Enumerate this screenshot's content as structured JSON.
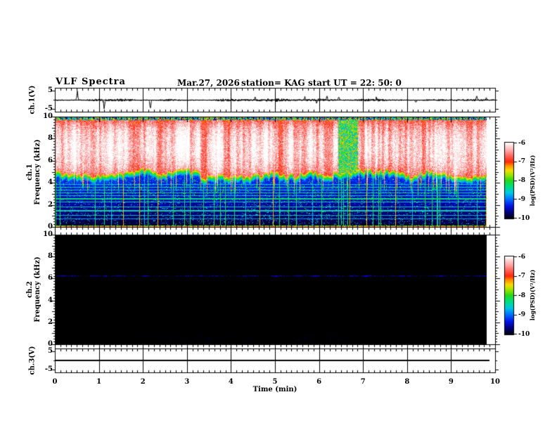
{
  "header": {
    "title": "VLF Spectra",
    "date": "Mar.27, 2026",
    "station": "station= KAG",
    "start_ut": "start UT =  22: 50: 0"
  },
  "time_axis": {
    "label": "Time (min)",
    "ticks": [
      "0",
      "1",
      "2",
      "3",
      "4",
      "5",
      "6",
      "7",
      "8",
      "9",
      "10"
    ],
    "range_min": [
      0,
      10
    ],
    "minor_ticks_per_major": 8
  },
  "chart_data": [
    {
      "type": "line",
      "id": "ch1-waveform",
      "ylabel": "ch.1(V)",
      "ylim": [
        -5,
        5
      ],
      "yticks": [
        "5",
        "-5"
      ],
      "baseline_v": 0,
      "noise_amp_v": 0.45,
      "grid": "vertical lines at every integer minute",
      "spikes": [
        {
          "t_min": 0.51,
          "amp_v": 5.0
        },
        {
          "t_min": 1.12,
          "amp_v": -4.6
        },
        {
          "t_min": 2.17,
          "amp_v": -4.4
        },
        {
          "t_min": 4.55,
          "amp_v": 1.4
        },
        {
          "t_min": 5.68,
          "amp_v": 1.6
        },
        {
          "t_min": 5.95,
          "amp_v": -1.4
        },
        {
          "t_min": 6.18,
          "amp_v": 2.3
        },
        {
          "t_min": 6.45,
          "amp_v": 1.5
        },
        {
          "t_min": 7.3,
          "amp_v": 1.1
        },
        {
          "t_min": 8.2,
          "amp_v": -1.2
        },
        {
          "t_min": 9.58,
          "amp_v": 2.2
        },
        {
          "t_min": 9.8,
          "amp_v": 1.0
        }
      ]
    },
    {
      "type": "heatmap",
      "id": "ch1-spectrogram",
      "ylabel_line1": "ch.1",
      "ylabel_line2": "Frequency (kHz)",
      "ylim": [
        0,
        10
      ],
      "yticks": [
        "10",
        "8",
        "6",
        "4",
        "2",
        "0"
      ],
      "data_end_min": 9.81,
      "features": {
        "strong_band_khz": [
          4.6,
          9.8
        ],
        "band_character": "saturated white/red vertical striations (sferics)",
        "fringe": "yellow-green-cyan transition below band",
        "background": "dark blue/black noise floor below 4 kHz",
        "horizontal_lines_khz": [
          3.9,
          3.65,
          3.4,
          3.15,
          2.9,
          2.6,
          2.3,
          1.85,
          1.5,
          1.1,
          0.75
        ],
        "vertical_line_density": 0.06,
        "bottom_edge_line_khz": 0.15
      },
      "colorbar": {
        "ticks": [
          "-6",
          "-7",
          "-8",
          "-9",
          "-10"
        ],
        "label": "log(PSD)(V²/Hz)",
        "range": [
          -10,
          -6
        ]
      }
    },
    {
      "type": "heatmap",
      "id": "ch2-spectrogram",
      "ylabel_line1": "ch.2",
      "ylabel_line2": "Frequency (kHz)",
      "ylim": [
        0,
        10
      ],
      "yticks": [
        "10",
        "8",
        "6",
        "4",
        "2",
        "0"
      ],
      "data_end_min": 9.81,
      "features": {
        "background": "black (below noise floor)",
        "narrowband_line_khz": 6.35,
        "narrowband_line_color": "#0000ff"
      },
      "colorbar": {
        "ticks": [
          "-6",
          "-7",
          "-8",
          "-9",
          "-10"
        ],
        "label": "log(PSD)(V²/Hz)",
        "range": [
          -10,
          -6
        ]
      }
    },
    {
      "type": "line",
      "id": "ch3-waveform",
      "ylabel": "ch.3(V)",
      "ylim": [
        -5,
        5
      ],
      "yticks": [
        "5",
        "-5"
      ],
      "baseline_v": 0,
      "flat": true,
      "data_end_min": 9.88
    }
  ],
  "colormap_stops": [
    [
      -10.0,
      2,
      2,
      18
    ],
    [
      -9.7,
      0,
      0,
      120
    ],
    [
      -9.35,
      0,
      20,
      230
    ],
    [
      -9.0,
      0,
      110,
      255
    ],
    [
      -8.65,
      0,
      200,
      230
    ],
    [
      -8.3,
      0,
      225,
      120
    ],
    [
      -8.0,
      40,
      215,
      30
    ],
    [
      -7.7,
      160,
      230,
      0
    ],
    [
      -7.45,
      250,
      220,
      0
    ],
    [
      -7.2,
      255,
      140,
      0
    ],
    [
      -7.0,
      255,
      40,
      10
    ],
    [
      -6.7,
      255,
      100,
      90
    ],
    [
      -6.4,
      255,
      170,
      170
    ],
    [
      -6.15,
      255,
      220,
      220
    ],
    [
      -6.0,
      255,
      255,
      255
    ]
  ],
  "colors": {
    "axis": "#000000",
    "background": "#ffffff",
    "ch2_line": "#0000ff"
  }
}
